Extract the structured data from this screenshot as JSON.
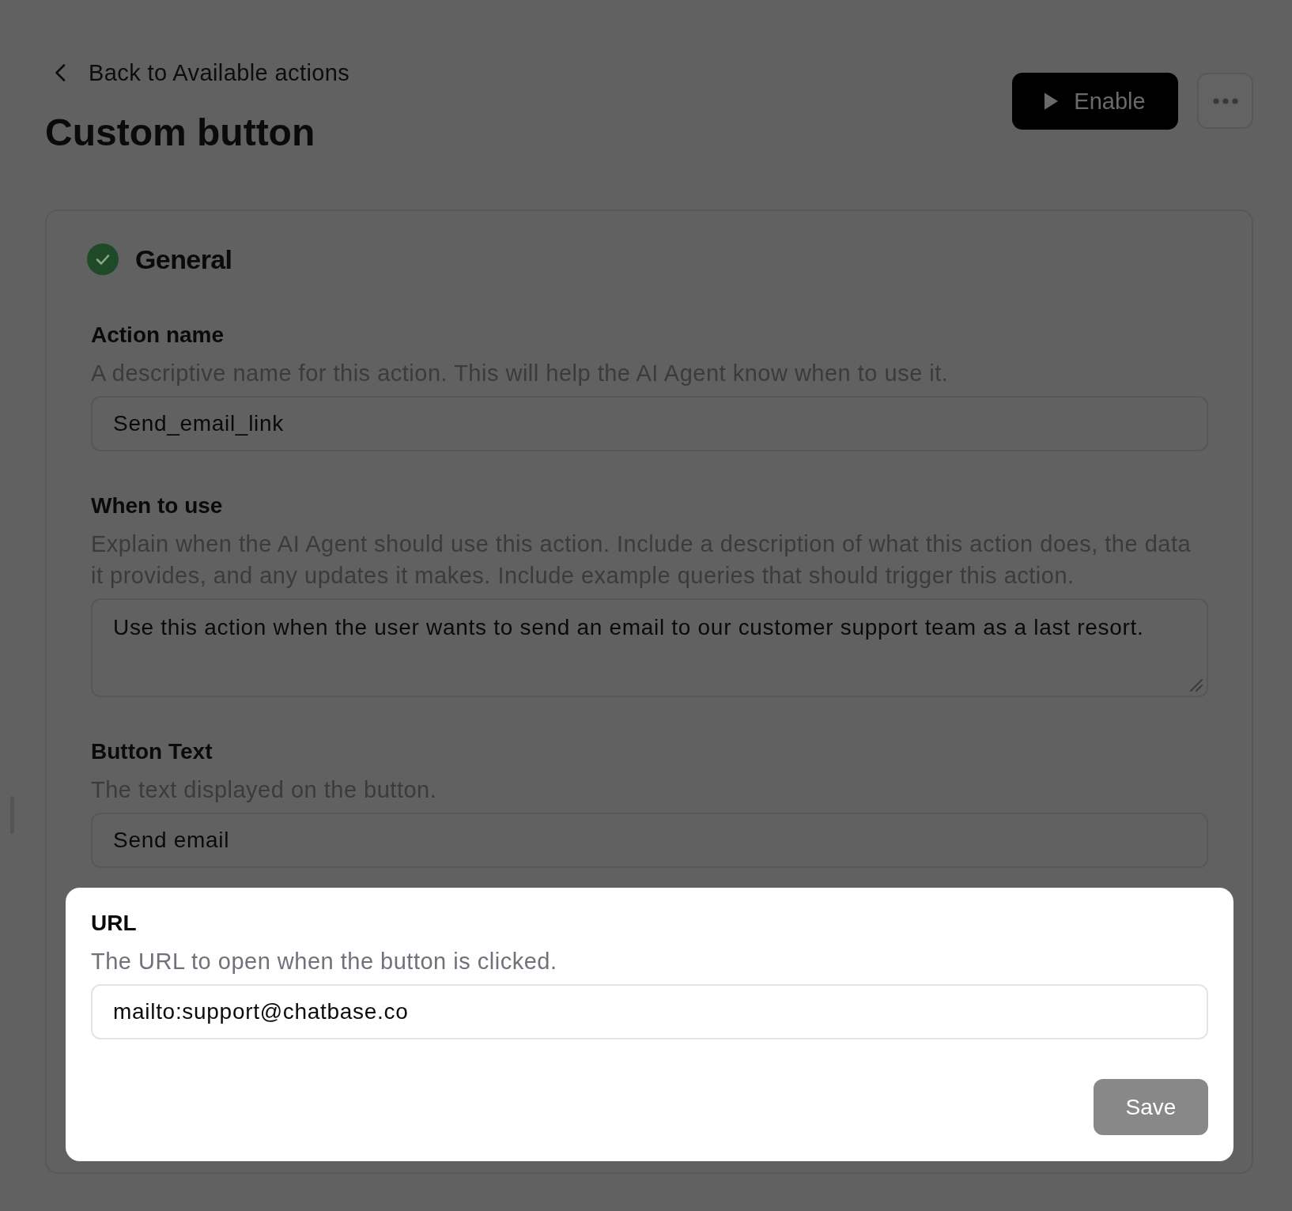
{
  "back_link": {
    "label": "Back to Available actions"
  },
  "page_title": "Custom button",
  "enable_button": {
    "label": "Enable"
  },
  "section": {
    "title": "General",
    "completed": true,
    "fields": [
      {
        "kind": "input",
        "label": "Action name",
        "description": "A descriptive name for this action. This will help the AI Agent know when to use it.",
        "value": "Send_email_link",
        "highlighted": false
      },
      {
        "kind": "textarea",
        "label": "When to use",
        "description": "Explain when the AI Agent should use this action. Include a description of what this action does, the data it provides, and any updates it makes. Include example queries that should trigger this action.",
        "value": "Use this action when the user wants to send an email to our customer support team as a last resort.",
        "highlighted": false
      },
      {
        "kind": "input",
        "label": "Button Text",
        "description": "The text displayed on the button.",
        "value": "Send email",
        "highlighted": false
      },
      {
        "kind": "input",
        "label": "URL",
        "description": "The URL to open when the button is clicked.",
        "value": "mailto:support@chatbase.co",
        "highlighted": true
      }
    ],
    "save_button": {
      "label": "Save",
      "disabled": true
    }
  }
}
